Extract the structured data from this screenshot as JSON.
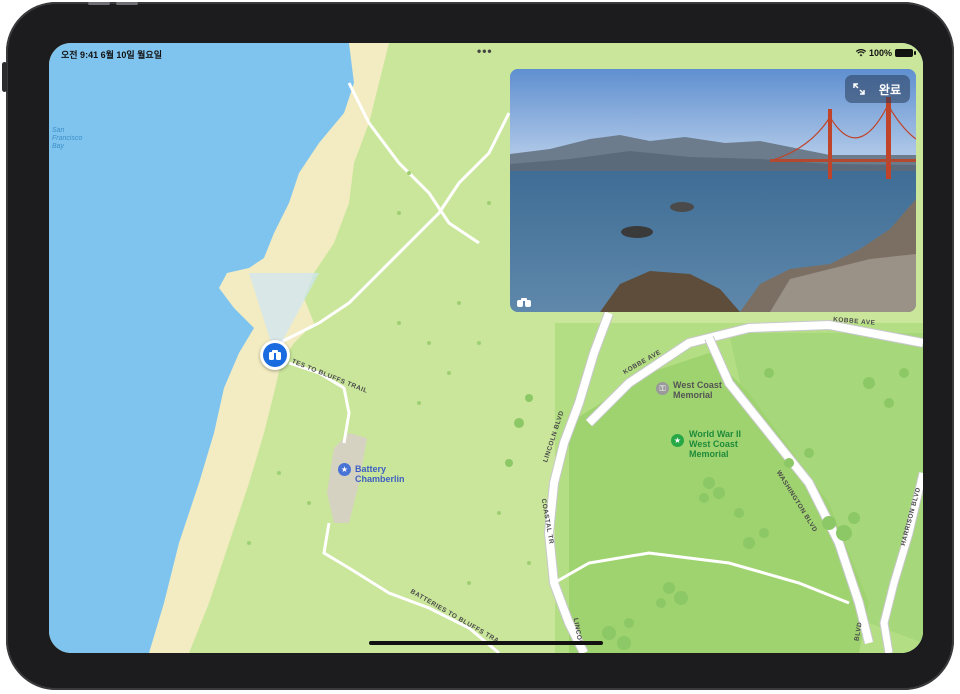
{
  "status_bar": {
    "time_date": "오전 9:41  6월 10일 월요일",
    "dots": "•••",
    "battery_pct": "100%"
  },
  "look_around": {
    "done_label": "완료",
    "expand_icon": "expand-arrows-icon",
    "binoculars_icon": "binoculars-icon"
  },
  "map": {
    "bay_label": "San\nFrancisco\nBay",
    "pois": {
      "battery_chamberlin": "Battery\nChamberlin",
      "west_coast_memorial": "West Coast\nMemorial",
      "ww2_memorial": "World War II\nWest Coast\nMemorial"
    },
    "streets": {
      "kobbe_ave_1": "KOBBE AVE",
      "kobbe_ave_2": "KOBBE AVE",
      "lincoln_blvd_1": "LINCOLN BLVD",
      "lincoln_blvd_2": "LINCOL",
      "washington_blvd": "WASHINGTON BLVD",
      "harrison_blvd": "HARRISON BLVD",
      "coastal_trail": "COASTAL TR",
      "batteries_trail_1": "TES TO BLUFFS TRAIL",
      "batteries_trail_2": "BATTERIES TO BLUFFS TRA",
      "blvd_bottom": "BLVD"
    }
  },
  "colors": {
    "water": "#7fc4ef",
    "sand": "#f3ecc2",
    "park": "#c9e69a",
    "park_dark": "#a9d97a",
    "accent": "#1a6be0",
    "road": "#ffffff"
  }
}
